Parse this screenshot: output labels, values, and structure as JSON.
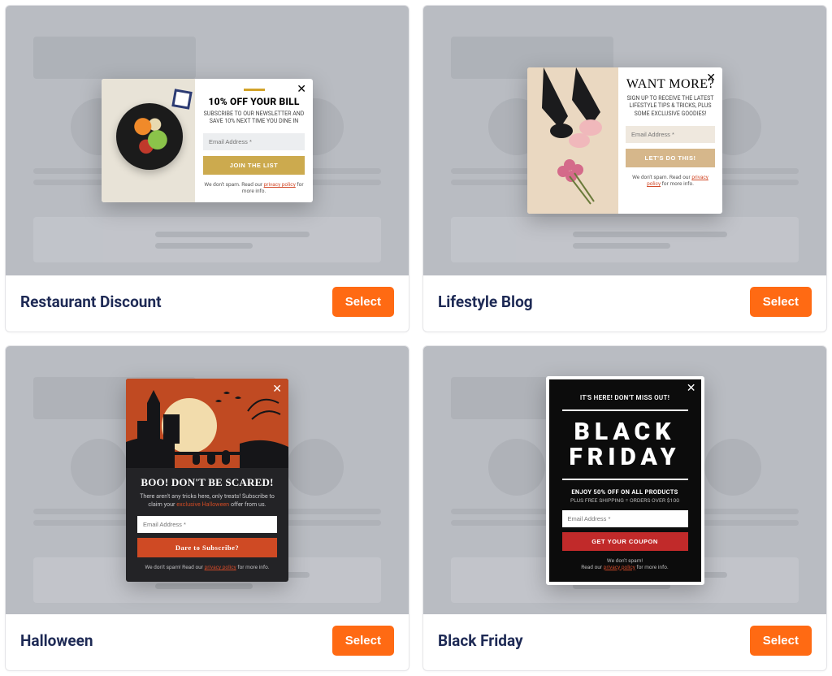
{
  "select_label": "Select",
  "templates": [
    {
      "name": "Restaurant Discount",
      "popup": {
        "heading": "10% OFF YOUR BILL",
        "sub": "SUBSCRIBE TO OUR NEWSLETTER AND SAVE 10% NEXT TIME YOU DINE IN",
        "placeholder": "Email Address *",
        "cta": "JOIN THE LIST",
        "fine_pre": "We don't spam. Read our ",
        "fine_link": "privacy policy",
        "fine_post": " for more info."
      }
    },
    {
      "name": "Lifestyle Blog",
      "popup": {
        "heading": "WANT MORE?",
        "sub": "SIGN UP TO RECEIVE THE LATEST LIFESTYLE TIPS & TRICKS, PLUS SOME EXCLUSIVE GOODIES!",
        "placeholder": "Email Address *",
        "cta": "LET'S DO THIS!",
        "fine_pre": "We don't spam. Read our ",
        "fine_link": "privacy policy",
        "fine_post": " for more info."
      }
    },
    {
      "name": "Halloween",
      "popup": {
        "heading": "BOO! DON'T BE SCARED!",
        "sub_pre": "There aren't any tricks here, only treats! Subscribe to claim your ",
        "sub_em": "exclusive Halloween",
        "sub_post": " offer from us.",
        "placeholder": "Email Address *",
        "cta": "Dare to Subscribe?",
        "fine_pre": "We don't spam! Read our ",
        "fine_link": "privacy policy",
        "fine_post": " for more info."
      }
    },
    {
      "name": "Black Friday",
      "popup": {
        "kicker": "IT'S HERE! DON'T MISS OUT!",
        "big1": "BLACK",
        "big2": "FRIDAY",
        "offer": "ENJOY 50% OFF ON ALL PRODUCTS",
        "ship": "PLUS FREE SHIPPING = ORDERS OVER $100",
        "placeholder": "Email Address *",
        "cta": "GET YOUR COUPON",
        "fine_l1": "We don't spam!",
        "fine_pre": "Read our ",
        "fine_link": "privacy policy",
        "fine_post": " for more info."
      }
    }
  ]
}
